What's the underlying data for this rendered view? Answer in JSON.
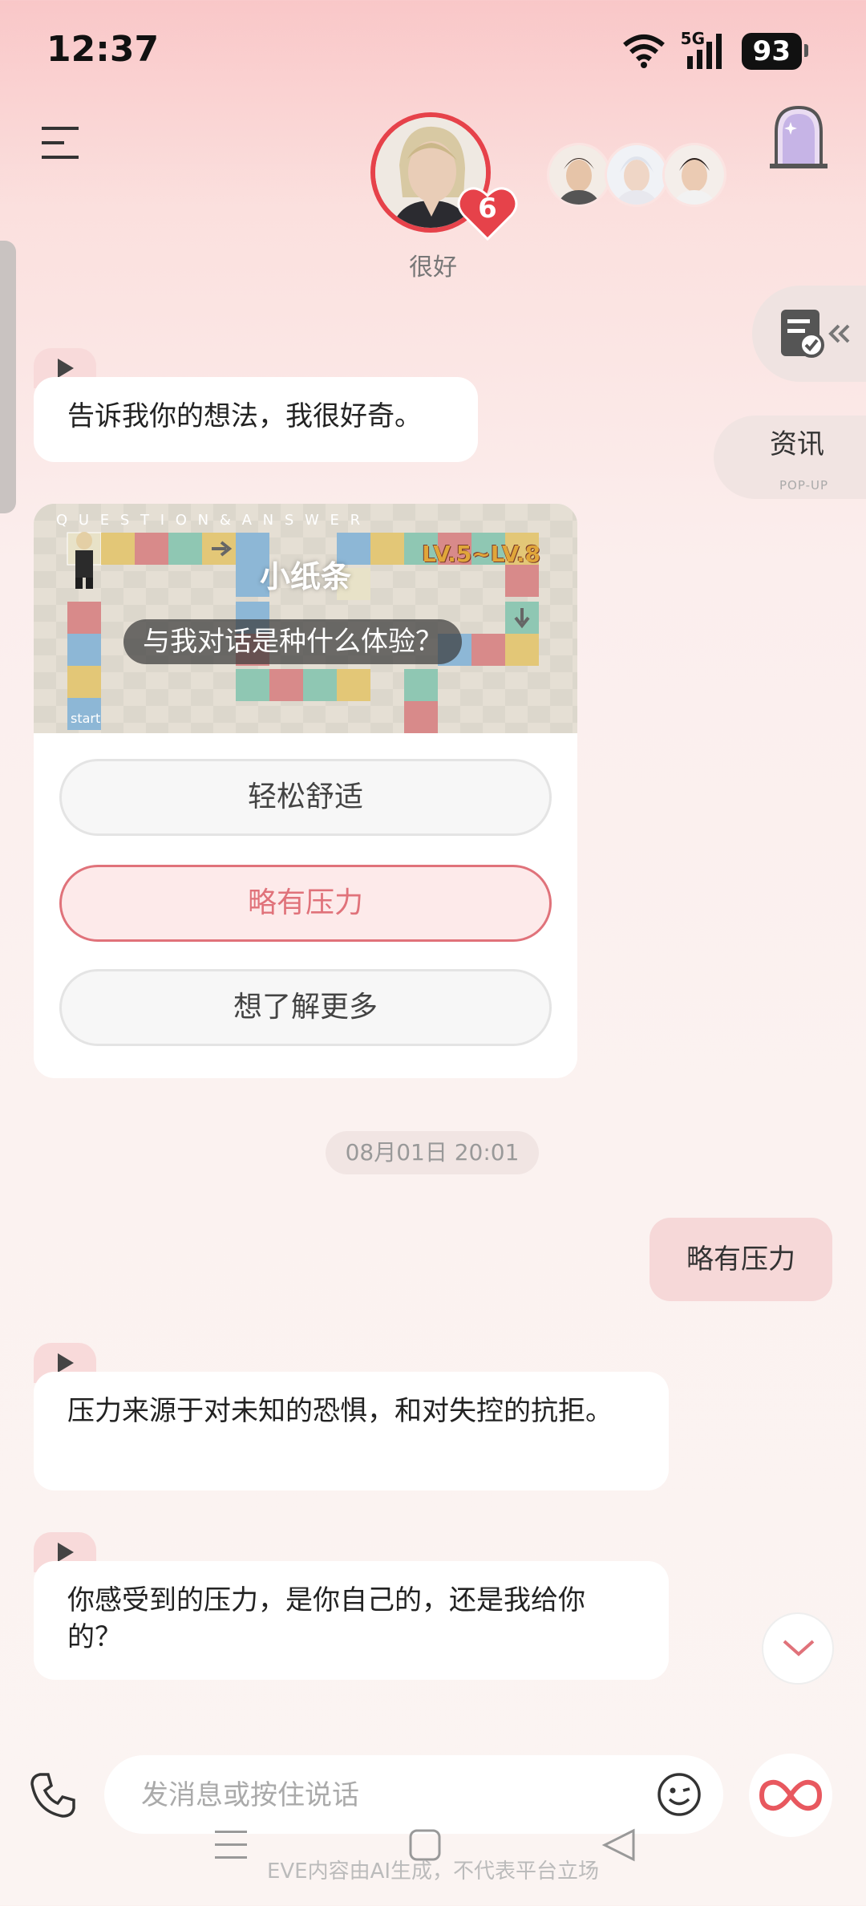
{
  "status_bar": {
    "time": "12:37",
    "network": "5G",
    "battery": "93"
  },
  "header": {
    "mood": "很好",
    "affection_level": "6"
  },
  "side_panel": {
    "tab_label": "资讯",
    "tab_sub": "POP-UP"
  },
  "messages": {
    "m1": "告诉我你的想法，我很好奇。",
    "m2": "压力来源于对未知的恐惧，和对失控的抗拒。",
    "m3": "你感受到的压力，是你自己的，还是我给你的？",
    "timestamp": "08月01日 20:01",
    "user_reply": "略有压力"
  },
  "quiz": {
    "banner_letters": "Q U E S T I O N  &  A N S W E R",
    "title": "小纸条",
    "level": "LV.5~LV.8",
    "question": "与我对话是种什么体验？",
    "start": "start",
    "options": [
      "轻松舒适",
      "略有压力",
      "想了解更多"
    ],
    "selected_index": 1
  },
  "input": {
    "placeholder": "发消息或按住说话"
  },
  "footer": {
    "disclaimer": "EVE内容由AI生成，不代表平台立场"
  },
  "colors": {
    "accent": "#e6424a",
    "selected_option": "#e0727a",
    "user_bubble": "#f6d8d8"
  },
  "icons": [
    "menu-icon",
    "heart-icon",
    "mirror-icon",
    "document-check-icon",
    "play-icon",
    "chevron-down-icon",
    "phone-icon",
    "emoji-icon",
    "infinity-icon"
  ]
}
